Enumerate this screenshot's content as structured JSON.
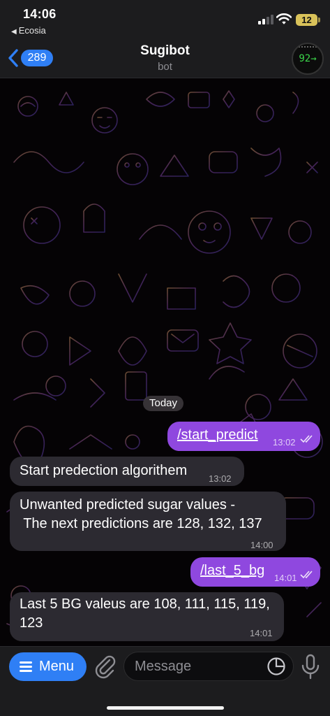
{
  "status_bar": {
    "time": "14:06",
    "back_app": "Ecosia",
    "battery": "12"
  },
  "header": {
    "back_count": "289",
    "title": "Sugibot",
    "subtitle": "bot",
    "avatar_reading": "92→"
  },
  "chat": {
    "date_label": "Today",
    "messages": [
      {
        "direction": "outgoing",
        "text": "/start_predict",
        "time": "13:02",
        "read": true
      },
      {
        "direction": "incoming",
        "text": "Start predection algorithem",
        "time": "13:02"
      },
      {
        "direction": "incoming",
        "line1": "Unwanted predicted sugar values -",
        "line2": " The next predictions are 128, 132, 137",
        "time": "14:00"
      },
      {
        "direction": "outgoing",
        "text": "/last_5_bg",
        "time": "14:01",
        "read": true
      },
      {
        "direction": "incoming",
        "line1": "Last 5 BG valeus are 108, 111, 115, 119,",
        "line2": "123",
        "time": "14:01"
      }
    ]
  },
  "composer": {
    "menu_label": "Menu",
    "placeholder": "Message"
  },
  "colors": {
    "accent": "#2f7ff5",
    "outgoing_bubble": "#8f48df",
    "incoming_bubble": "#2c2a31",
    "glucose_reading": "#3bd64a",
    "battery": "#d9c25a"
  }
}
